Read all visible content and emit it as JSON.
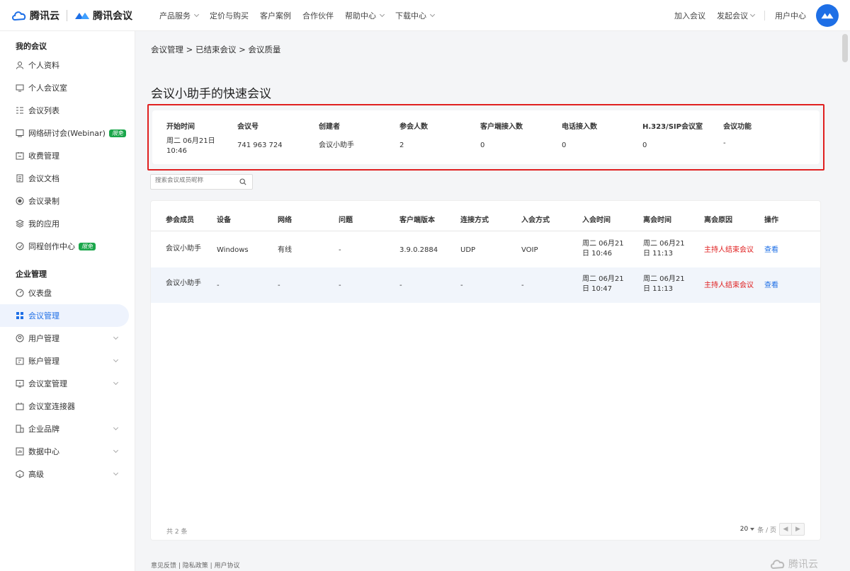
{
  "header": {
    "brand1": "腾讯云",
    "brand2": "腾讯会议",
    "nav": [
      {
        "label": "产品服务",
        "dropdown": true
      },
      {
        "label": "定价与购买",
        "dropdown": false
      },
      {
        "label": "客户案例",
        "dropdown": false
      },
      {
        "label": "合作伙伴",
        "dropdown": false
      },
      {
        "label": "帮助中心",
        "dropdown": true
      },
      {
        "label": "下载中心",
        "dropdown": true
      }
    ],
    "right": {
      "join": "加入会议",
      "start": "发起会议",
      "user_center": "用户中心"
    },
    "accent": "#1e6fe6"
  },
  "sidebar": {
    "sections": [
      {
        "title": "我的会议",
        "items": [
          {
            "label": "个人资料",
            "icon": "user-icon"
          },
          {
            "label": "个人会议室",
            "icon": "meeting-room-icon"
          },
          {
            "label": "会议列表",
            "icon": "list-icon"
          },
          {
            "label": "网络研讨会(Webinar)",
            "icon": "webinar-icon",
            "badge": "限免"
          },
          {
            "label": "收费管理",
            "icon": "billing-icon"
          },
          {
            "label": "会议文档",
            "icon": "document-icon"
          },
          {
            "label": "会议录制",
            "icon": "record-icon"
          },
          {
            "label": "我的应用",
            "icon": "apps-icon"
          },
          {
            "label": "同程创作中心",
            "icon": "create-icon",
            "badge": "限免"
          }
        ]
      },
      {
        "title": "企业管理",
        "items": [
          {
            "label": "仪表盘",
            "icon": "dashboard-icon"
          },
          {
            "label": "会议管理",
            "icon": "grid-icon",
            "active": true
          },
          {
            "label": "用户管理",
            "icon": "users-icon",
            "expand": true
          },
          {
            "label": "账户管理",
            "icon": "account-icon",
            "expand": true
          },
          {
            "label": "会议室管理",
            "icon": "room-manage-icon",
            "expand": true
          },
          {
            "label": "会议室连接器",
            "icon": "connector-icon"
          },
          {
            "label": "企业品牌",
            "icon": "brand-icon",
            "expand": true
          },
          {
            "label": "数据中心",
            "icon": "data-icon",
            "expand": true
          },
          {
            "label": "高级",
            "icon": "advanced-icon",
            "expand": true
          }
        ]
      }
    ]
  },
  "breadcrumb": "会议管理 > 已结束会议 > 会议质量",
  "page_title": "会议小助手的快速会议",
  "meeting_info": {
    "headers": [
      "开始时间",
      "会议号",
      "创建者",
      "参会人数",
      "客户端接入数",
      "电话接入数",
      "H.323/SIP会议室",
      "会议功能"
    ],
    "values": [
      "周二 06月21日\n10:46",
      "741 963 724",
      "会议小助手",
      "2",
      "0",
      "0",
      "0",
      "-"
    ]
  },
  "search": {
    "placeholder": "搜索会议成员昵称"
  },
  "table": {
    "headers": [
      "参会成员",
      "设备",
      "网络",
      "问题",
      "客户端版本",
      "连接方式",
      "入会方式",
      "入会时间",
      "离会时间",
      "离会原因",
      "操作"
    ],
    "rows": [
      [
        "会议小助手",
        "Windows",
        "有线",
        "-",
        "3.9.0.2884",
        "UDP",
        "VOIP",
        "周二 06月21\n日 10:46",
        "周二 06月21\n日 11:13",
        "主持人结束会议",
        "查看"
      ],
      [
        "会议小助手",
        "-",
        "-",
        "-",
        "-",
        "-",
        "-",
        "周二 06月21\n日 10:47",
        "周二 06月21\n日 11:13",
        "主持人结束会议",
        "查看"
      ]
    ],
    "total": "共 2 条",
    "page_size": "20",
    "per_page": "条 / 页"
  },
  "footer": {
    "links": "意见反馈 | 隐私政策 | 用户协议",
    "brand": "腾讯云"
  }
}
